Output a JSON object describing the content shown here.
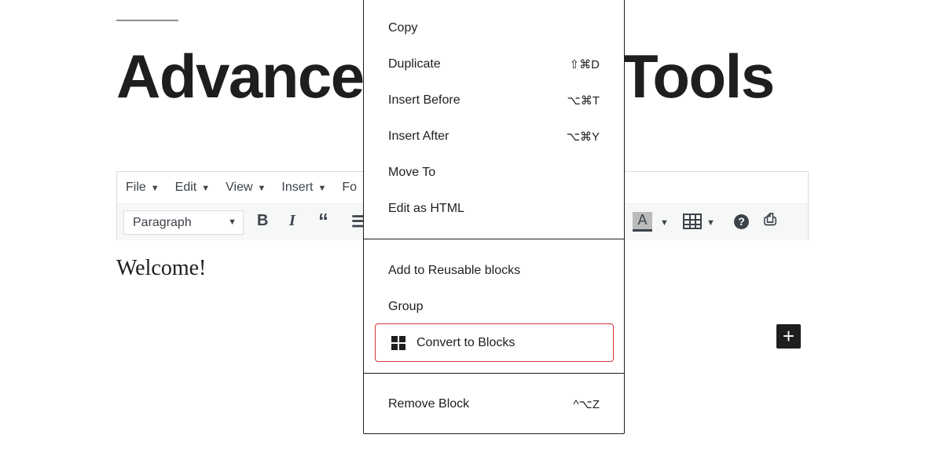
{
  "post": {
    "title_left": "Advance",
    "title_right": "Tools",
    "welcome": "Welcome!"
  },
  "classic": {
    "menus": [
      "File",
      "Edit",
      "View",
      "Insert",
      "Fo"
    ],
    "format_select": "Paragraph",
    "icons": [
      "bold-icon",
      "italic-icon",
      "blockquote-icon",
      "bullet-list-icon",
      "text-color-icon",
      "table-icon",
      "help-icon",
      "media-icon"
    ]
  },
  "block_menu": {
    "sections": [
      [
        {
          "label": "Copy",
          "shortcut": ""
        },
        {
          "label": "Duplicate",
          "shortcut": "⇧⌘D"
        },
        {
          "label": "Insert Before",
          "shortcut": "⌥⌘T"
        },
        {
          "label": "Insert After",
          "shortcut": "⌥⌘Y"
        },
        {
          "label": "Move To",
          "shortcut": ""
        },
        {
          "label": "Edit as HTML",
          "shortcut": ""
        }
      ],
      [
        {
          "label": "Add to Reusable blocks",
          "shortcut": ""
        },
        {
          "label": "Group",
          "shortcut": ""
        },
        {
          "label": "Convert to Blocks",
          "shortcut": "",
          "highlighted": true
        }
      ],
      [
        {
          "label": "Remove Block",
          "shortcut": "^⌥Z"
        }
      ]
    ]
  },
  "add_block": "+",
  "colors": {
    "highlight": "#d63638",
    "dark": "#1e1e1e"
  }
}
